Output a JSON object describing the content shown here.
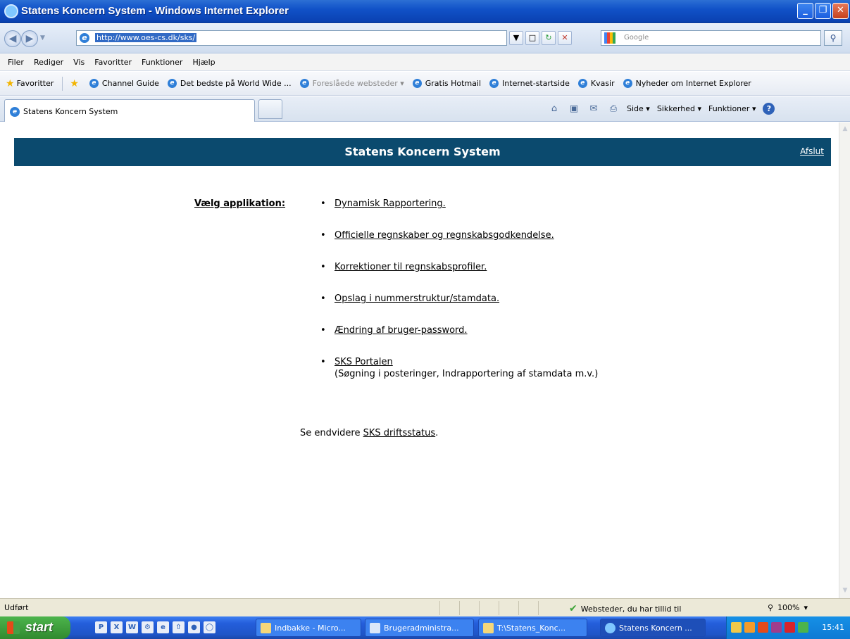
{
  "window": {
    "title": "Statens Koncern System - Windows Internet Explorer",
    "min_glyph": "_",
    "max_glyph": "❐",
    "close_glyph": "✕"
  },
  "address": {
    "url": "http://www.oes-cs.dk/sks/",
    "search_placeholder": "Google"
  },
  "menu": [
    "Filer",
    "Rediger",
    "Vis",
    "Favoritter",
    "Funktioner",
    "Hjælp"
  ],
  "favorites": {
    "label": "Favoritter",
    "items": [
      {
        "label": "Channel Guide"
      },
      {
        "label": "Det bedste på World Wide ..."
      },
      {
        "label": "Foreslåede websteder ▾"
      },
      {
        "label": "Gratis Hotmail"
      },
      {
        "label": "Internet-startside"
      },
      {
        "label": "Kvasir"
      },
      {
        "label": "Nyheder om Internet Explorer"
      }
    ]
  },
  "tab": {
    "label": "Statens Koncern System"
  },
  "commandbar": {
    "page": "Side ▾",
    "safety": "Sikkerhed ▾",
    "tools": "Funktioner ▾"
  },
  "page": {
    "title": "Statens Koncern System",
    "logout": "Afslut",
    "choose_label": "Vælg applikation:",
    "apps": [
      {
        "label": "Dynamisk Rapportering.",
        "sub": ""
      },
      {
        "label": "Officielle regnskaber og regnskabsgodkendelse.",
        "sub": ""
      },
      {
        "label": "Korrektioner til regnskabsprofiler.",
        "sub": ""
      },
      {
        "label": "Opslag i nummerstruktur/stamdata.",
        "sub": ""
      },
      {
        "label": "Ændring af bruger-password.",
        "sub": ""
      },
      {
        "label": "SKS Portalen",
        "sub": "(Søgning i posteringer, Indrapportering af stamdata m.v.)"
      }
    ],
    "footer_prefix": "Se endvidere ",
    "footer_link": "SKS driftsstatus",
    "footer_suffix": "."
  },
  "status": {
    "text": "Udført",
    "zone": "Websteder, du har tillid til",
    "zoom": "100%"
  },
  "taskbar": {
    "start": "start",
    "tasks": [
      {
        "label": "Indbakke - Micro..."
      },
      {
        "label": "Brugeradministra..."
      },
      {
        "label": "T:\\Statens_Konc..."
      },
      {
        "label": "Statens Koncern ..."
      }
    ],
    "clock": "15:41"
  },
  "colors": {
    "header_band": "#0b4a6e",
    "titlebar": "#0b43b4",
    "taskbar": "#245edb"
  }
}
